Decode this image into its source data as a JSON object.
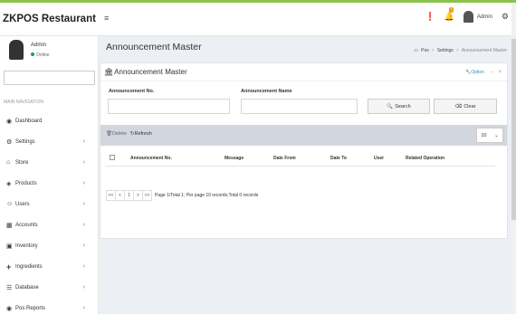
{
  "brand": "ZKPOS Restaurant",
  "header": {
    "hamburger_icon": "≡",
    "user_name": "Admin",
    "bell_badge": "!"
  },
  "sidebar": {
    "user": {
      "name": "Admin",
      "status": "Online"
    },
    "nav_header": "MAIN NAVIGATION",
    "items": [
      {
        "label": "Dashboard",
        "icon": "dashboard-icon",
        "chevron": false
      },
      {
        "label": "Settings",
        "icon": "gear-icon",
        "chevron": true
      },
      {
        "label": "Store",
        "icon": "home-icon",
        "chevron": true
      },
      {
        "label": "Products",
        "icon": "tag-icon",
        "chevron": true
      },
      {
        "label": "Users",
        "icon": "user-icon",
        "chevron": true
      },
      {
        "label": "Accounts",
        "icon": "table-icon",
        "chevron": true
      },
      {
        "label": "Inventory",
        "icon": "truck-icon",
        "chevron": true
      },
      {
        "label": "Ingredients",
        "icon": "plus-icon",
        "chevron": true
      },
      {
        "label": "Database",
        "icon": "database-icon",
        "chevron": true
      },
      {
        "label": "Pos Reports",
        "icon": "eye-icon",
        "chevron": true
      }
    ]
  },
  "page": {
    "title": "Announcement Master",
    "breadcrumb": [
      "Pos",
      "Settings",
      "Announcement Master"
    ]
  },
  "box": {
    "title": "Announcement Master",
    "option_label": "Option",
    "search": {
      "no_label": "Announcement No.",
      "no_value": "",
      "name_label": "Announcement Name",
      "name_value": "",
      "search_button": "Search",
      "clear_button": "Clear"
    },
    "toolbar": {
      "delete_label": "Delete",
      "refresh_label": "Refresh",
      "page_size": "10"
    },
    "table": {
      "columns": [
        "Announcement No.",
        "Message",
        "Date From",
        "Date To",
        "User",
        "Related Operation"
      ]
    },
    "pager": {
      "first": "<<",
      "prev": "<",
      "current": "1",
      "next": ">",
      "last": ">>",
      "info": "Page 1/Total 1; Per page 10 records;Total 0 records"
    }
  },
  "colors": {
    "accent_top": "#8bc34a",
    "link": "#3c8dbc",
    "online": "#00a65a",
    "badge": "#f39c12"
  }
}
